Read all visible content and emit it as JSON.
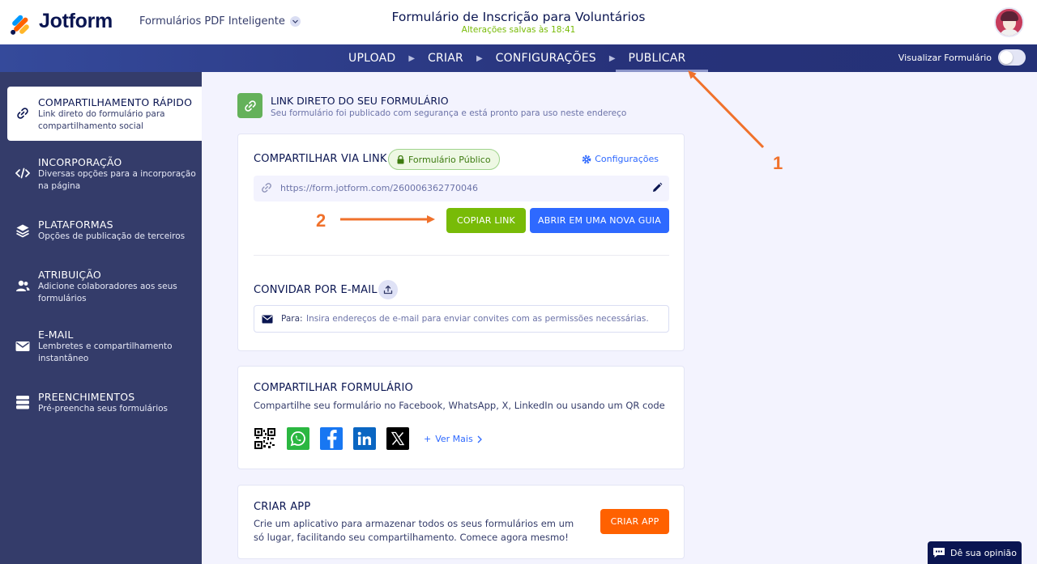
{
  "app": {
    "brand": "Jotform",
    "product_switcher": "Formulários PDF Inteligente",
    "form_title": "Formulário de Inscrição para Voluntários",
    "save_status": "Alterações salvas às 18:41"
  },
  "nav": {
    "steps": [
      {
        "label": "UPLOAD"
      },
      {
        "label": "CRIAR"
      },
      {
        "label": "CONFIGURAÇÕES"
      },
      {
        "label": "PUBLICAR",
        "active": true
      }
    ],
    "preview_label": "Visualizar Formulário",
    "preview_on": false
  },
  "sidebar": {
    "items": [
      {
        "title": "COMPARTILHAMENTO RÁPIDO",
        "desc": "Link direto do formulário para compartilhamento social",
        "icon": "link-icon",
        "active": true
      },
      {
        "title": "INCORPORAÇÃO",
        "desc": "Diversas opções para a incorporação na página",
        "icon": "code-icon"
      },
      {
        "title": "PLATAFORMAS",
        "desc": "Opções de publicação de terceiros",
        "icon": "layers-icon"
      },
      {
        "title": "ATRIBUIÇÃO",
        "desc": "Adicione colaboradores aos seus formulários",
        "icon": "users-icon"
      },
      {
        "title": "E-MAIL",
        "desc": "Lembretes e compartilhamento instantâneo",
        "icon": "mail-icon"
      },
      {
        "title": "PREENCHIMENTOS",
        "desc": "Pré-preencha seus formulários",
        "icon": "database-icon"
      }
    ]
  },
  "main": {
    "header_title": "LINK DIRETO DO SEU FORMULÁRIO",
    "header_sub": "Seu formulário foi publicado com segurança e está pronto para uso neste endereço",
    "share_link": {
      "title": "COMPARTILHAR VIA LINK",
      "badge": "Formulário Público",
      "settings": "Configurações",
      "url": "https://form.jotform.com/260006362770046",
      "copy_button": "COPIAR LINK",
      "open_button": "ABRIR EM UMA NOVA GUIA"
    },
    "invite": {
      "title": "CONVIDAR POR E-MAIL",
      "to_label": "Para:",
      "placeholder": "Insira endereços de e-mail para enviar convites com as permissões necessárias."
    },
    "share_form": {
      "title": "COMPARTILHAR FORMULÁRIO",
      "desc": "Compartilhe seu formulário no Facebook, WhatsApp, X, LinkedIn ou usando um QR code",
      "icons": [
        "qr-code-icon",
        "whatsapp-icon",
        "facebook-icon",
        "linkedin-icon",
        "x-icon"
      ],
      "see_more": "Ver Mais"
    },
    "create_app": {
      "title": "CRIAR APP",
      "desc": "Crie um aplicativo para armazenar todos os seus formulários em um só lugar, facilitando seu compartilhamento. Comece agora mesmo!",
      "button": "CRIAR APP"
    }
  },
  "annotations": [
    {
      "label": "1",
      "target": "PUBLICAR"
    },
    {
      "label": "2",
      "target": "COPIAR LINK"
    }
  ],
  "feedback": "Dê sua opinião",
  "colors": {
    "nav_bg": "#27327a",
    "sidebar_bg": "#343c6a",
    "copy_green": "#78bb07",
    "open_blue": "#2e69ff",
    "app_orange": "#ff6100",
    "annotation_orange": "#f0712b"
  }
}
